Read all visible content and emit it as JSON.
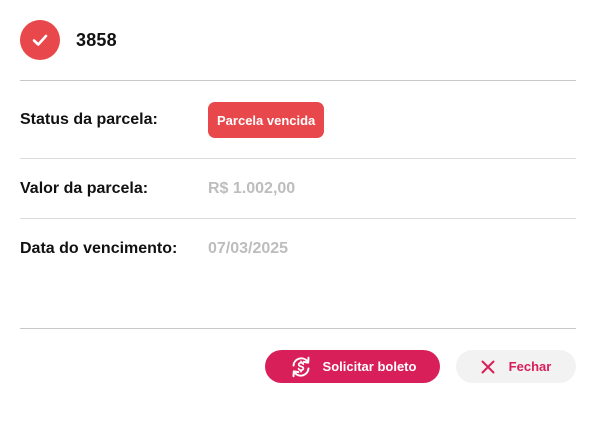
{
  "header": {
    "title": "3858",
    "icon": "check-icon",
    "icon_color": "#e8474b"
  },
  "details": {
    "status": {
      "label": "Status da parcela:",
      "value": "Parcela vencida",
      "badge_color": "#e8474b"
    },
    "amount": {
      "label": "Valor da parcela:",
      "value": "R$ 1.002,00"
    },
    "due_date": {
      "label": "Data do vencimento:",
      "value": "07/03/2025"
    }
  },
  "actions": {
    "request_boleto": {
      "label": "Solicitar boleto",
      "icon": "refresh-dollar-icon",
      "color": "#d81f5a"
    },
    "close": {
      "label": "Fechar",
      "icon": "close-icon"
    }
  }
}
